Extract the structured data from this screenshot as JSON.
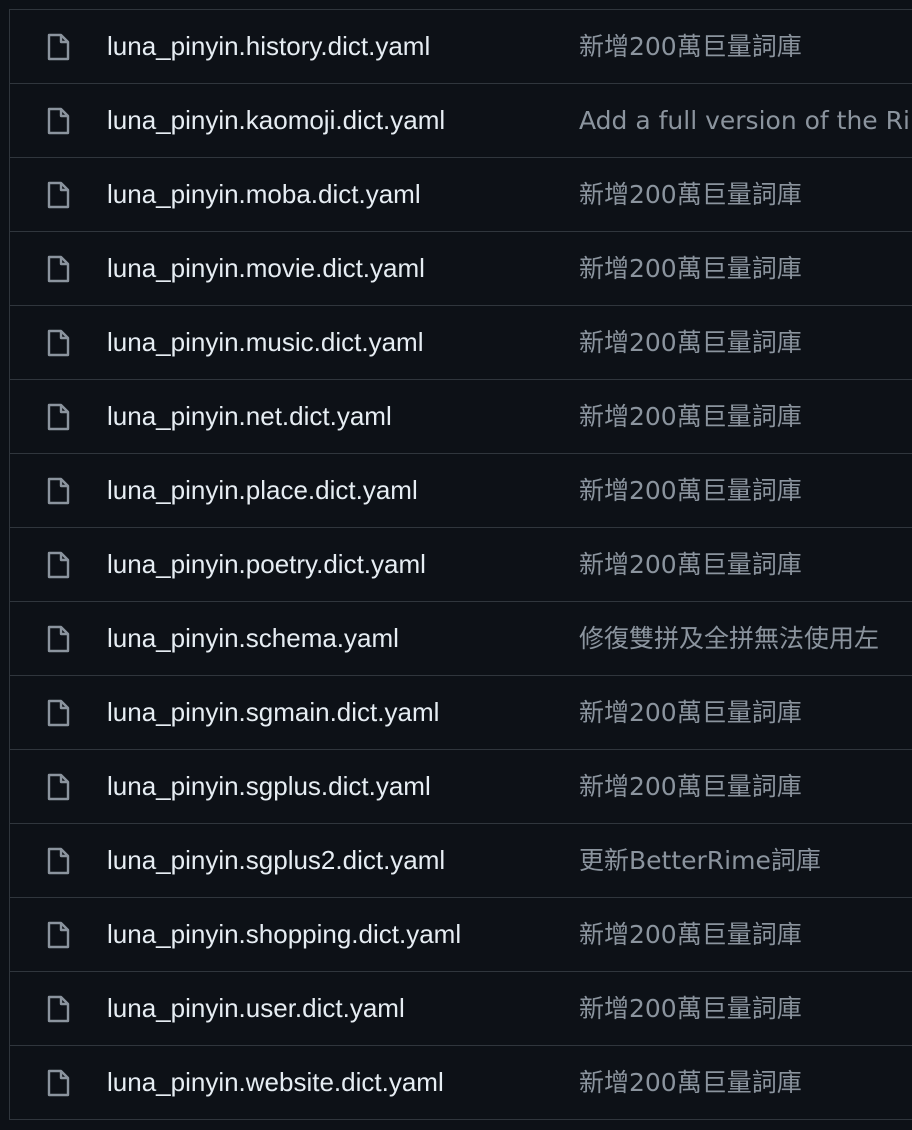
{
  "files": [
    {
      "name": "luna_pinyin.history.dict.yaml",
      "message": "新增200萬巨量詞庫",
      "icon": "file-icon"
    },
    {
      "name": "luna_pinyin.kaomoji.dict.yaml",
      "message": "Add a full version of the Ri",
      "icon": "file-icon"
    },
    {
      "name": "luna_pinyin.moba.dict.yaml",
      "message": "新增200萬巨量詞庫",
      "icon": "file-icon"
    },
    {
      "name": "luna_pinyin.movie.dict.yaml",
      "message": "新增200萬巨量詞庫",
      "icon": "file-icon"
    },
    {
      "name": "luna_pinyin.music.dict.yaml",
      "message": "新增200萬巨量詞庫",
      "icon": "file-icon"
    },
    {
      "name": "luna_pinyin.net.dict.yaml",
      "message": "新增200萬巨量詞庫",
      "icon": "file-icon"
    },
    {
      "name": "luna_pinyin.place.dict.yaml",
      "message": "新增200萬巨量詞庫",
      "icon": "file-icon"
    },
    {
      "name": "luna_pinyin.poetry.dict.yaml",
      "message": "新增200萬巨量詞庫",
      "icon": "file-icon"
    },
    {
      "name": "luna_pinyin.schema.yaml",
      "message": "修復雙拼及全拼無法使用左",
      "icon": "file-icon"
    },
    {
      "name": "luna_pinyin.sgmain.dict.yaml",
      "message": "新增200萬巨量詞庫",
      "icon": "file-icon"
    },
    {
      "name": "luna_pinyin.sgplus.dict.yaml",
      "message": "新增200萬巨量詞庫",
      "icon": "file-icon"
    },
    {
      "name": "luna_pinyin.sgplus2.dict.yaml",
      "message": "更新BetterRime詞庫",
      "icon": "file-icon"
    },
    {
      "name": "luna_pinyin.shopping.dict.yaml",
      "message": "新增200萬巨量詞庫",
      "icon": "file-icon"
    },
    {
      "name": "luna_pinyin.user.dict.yaml",
      "message": "新增200萬巨量詞庫",
      "icon": "file-icon"
    },
    {
      "name": "luna_pinyin.website.dict.yaml",
      "message": "新增200萬巨量詞庫",
      "icon": "file-icon"
    }
  ],
  "colors": {
    "background": "#0d1117",
    "border": "#30363d",
    "filename": "#e6edf3",
    "commit_message": "#8b949e",
    "icon": "#8b949e"
  }
}
